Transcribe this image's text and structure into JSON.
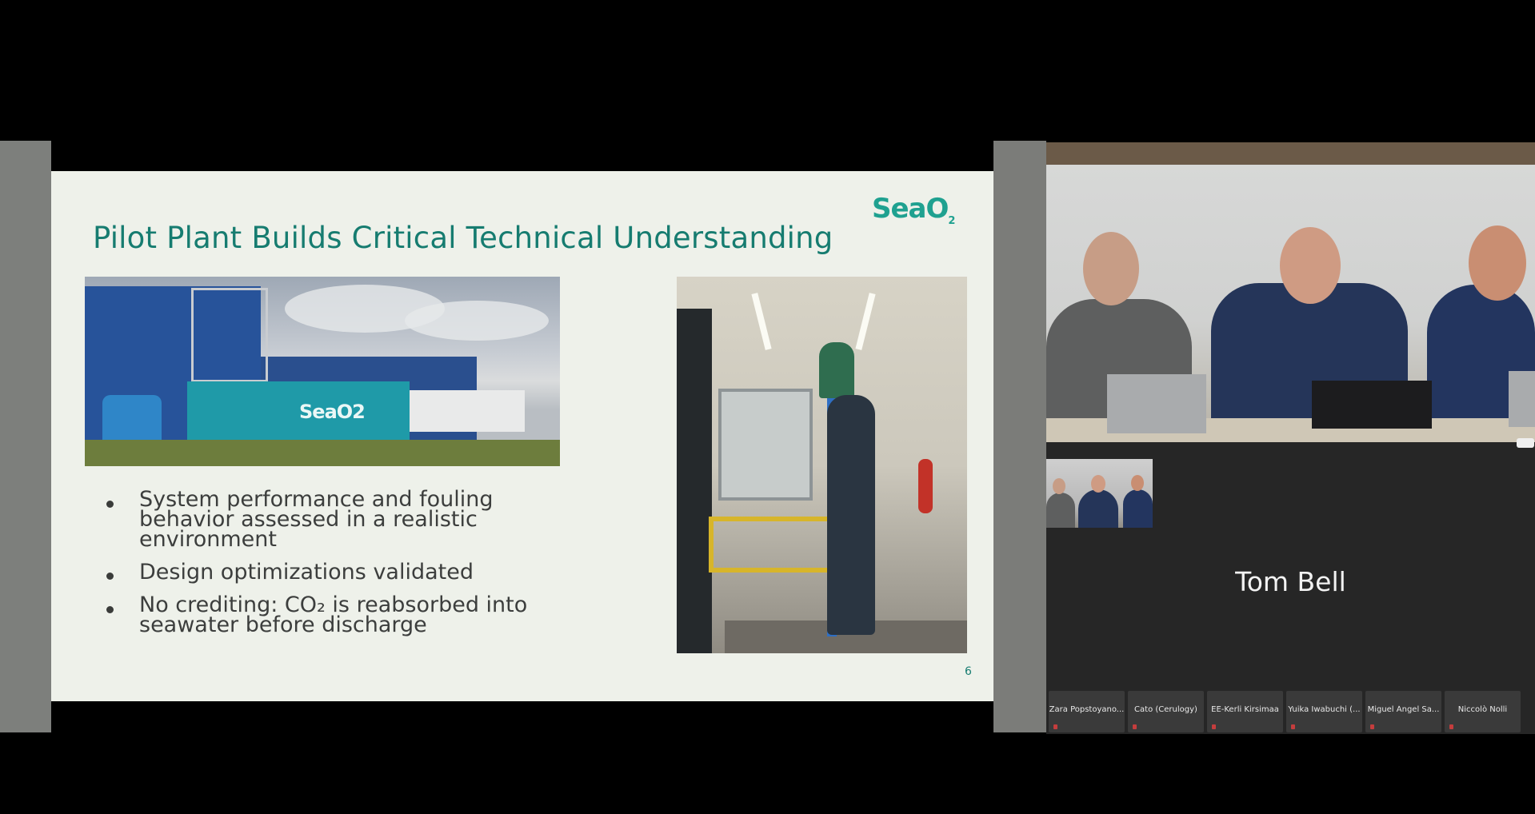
{
  "slide": {
    "title": "Pilot Plant Builds Critical Technical Understanding",
    "brand": "SeaO",
    "brand_sub": "2",
    "plant_container_label": "SeaO2",
    "bullets": [
      "System performance and fouling behavior assessed in a realistic environment",
      "Design optimizations validated",
      "No crediting: CO₂ is reabsorbed into seawater before discharge"
    ],
    "page_number": "6"
  },
  "video": {
    "speaker_name": "Tom Bell",
    "participants": [
      "Zara Popstoyano...",
      "Cato (Cerulogy)",
      "EE-Kerli Kirsimaa",
      "Yuika Iwabuchi (...",
      "Miguel Ángel Sa...",
      "Niccolò Nolli"
    ]
  },
  "colors": {
    "title": "#167c70",
    "brand": "#1fa190",
    "slide_bg": "#eef1ea",
    "video_bg": "#262626"
  }
}
